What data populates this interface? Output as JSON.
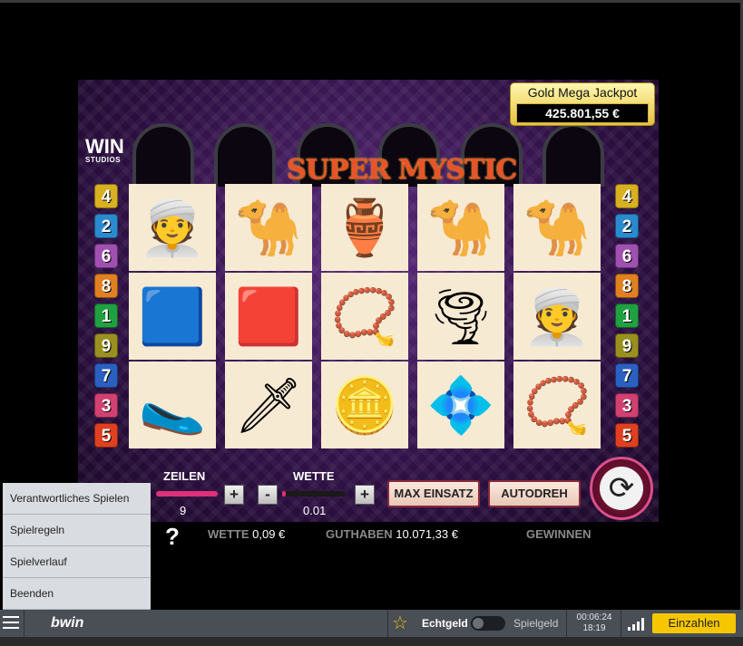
{
  "game": {
    "studio_logo": "WIN",
    "studio_logo_sub": "STUDIOS",
    "title": "SUPER MYSTIC",
    "jackpot_label": "Gold Mega Jackpot",
    "jackpot_value": "425.801,55 €",
    "paylines_left": [
      "4",
      "2",
      "6",
      "8",
      "1",
      "9",
      "7",
      "3",
      "5"
    ],
    "paylines_right": [
      "4",
      "2",
      "6",
      "8",
      "1",
      "9",
      "7",
      "3",
      "5"
    ],
    "payline_colors": [
      "#d8b020",
      "#2a8ad0",
      "#a050b0",
      "#e08020",
      "#20a040",
      "#9a9020",
      "#2a60c0",
      "#d04070",
      "#e04020"
    ],
    "reels": [
      [
        "woman-turban",
        "magic-carpet",
        "genie-slipper"
      ],
      [
        "camel",
        "red-cushion",
        "dagger"
      ],
      [
        "golden-teapot",
        "gold-necklace",
        "gold-coin"
      ],
      [
        "camel",
        "tornado",
        "jeweled-brooch"
      ],
      [
        "camel",
        "woman-turban",
        "gold-necklace"
      ]
    ],
    "symbol_glyphs": {
      "woman-turban": "👳",
      "magic-carpet": "🟦",
      "genie-slipper": "🥿",
      "camel": "🐪",
      "red-cushion": "🟥",
      "dagger": "🗡",
      "golden-teapot": "🏺",
      "gold-necklace": "📿",
      "gold-coin": "🪙",
      "tornado": "🌪",
      "jeweled-brooch": "💠"
    }
  },
  "controls": {
    "lines_label": "ZEILEN",
    "lines_value": "9",
    "lines_fill": 1.0,
    "bet_label": "WETTE",
    "bet_value": "0.01",
    "bet_fill": 0.0,
    "plus": "+",
    "minus": "-",
    "max_bet": "MAX EINSATZ",
    "autoplay": "AUTODREH",
    "spin_icon": "refresh-icon"
  },
  "info": {
    "help": "?",
    "bet_key": "WETTE",
    "bet_val": "0,09 €",
    "balance_key": "GUTHABEN",
    "balance_val": "10.071,33 €",
    "win_key": "GEWINNEN"
  },
  "menu": {
    "items": [
      "Verantwortliches Spielen",
      "Spielregeln",
      "Spielverlauf",
      "Beenden"
    ]
  },
  "bottombar": {
    "brand": "bwin",
    "real_money": "Echtgeld",
    "play_money": "Spielgeld",
    "session_time": "00:06:24",
    "clock": "18:19",
    "deposit": "Einzahlen",
    "accent": "#f6c700"
  }
}
